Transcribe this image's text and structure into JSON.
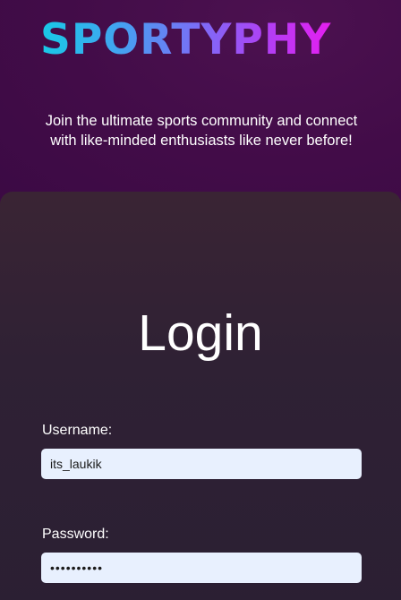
{
  "brand": {
    "name": "SPORTYPHY",
    "gradient_colors": [
      "#18c9e6",
      "#7c6cf6",
      "#e51ef0"
    ]
  },
  "hero": {
    "tagline": "Join the ultimate sports community and connect with like-minded enthusiasts like never before!"
  },
  "login": {
    "title": "Login",
    "username_label": "Username:",
    "username_value": "its_laukik",
    "password_label": "Password:",
    "password_value": "••••••••••"
  },
  "colors": {
    "background": "#420c48",
    "card": "#2f2134",
    "input_bg": "#e8f0fe",
    "text": "#ffffff"
  }
}
